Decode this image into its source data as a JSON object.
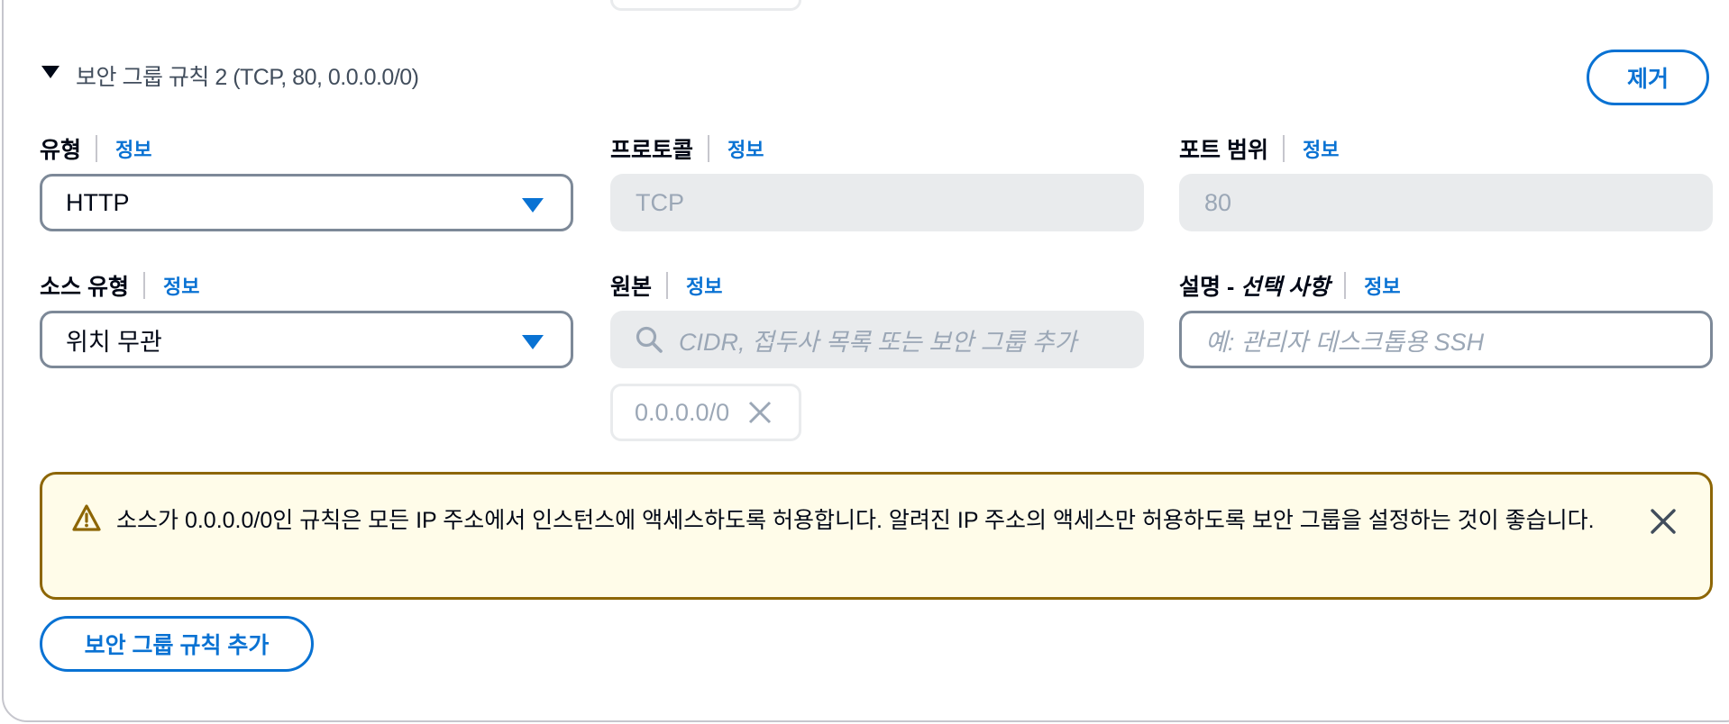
{
  "rule": {
    "title": "보안 그룹 규칙 2 (TCP, 80, 0.0.0.0/0)",
    "remove_label": "제거"
  },
  "fields": {
    "type": {
      "label": "유형",
      "info": "정보",
      "value": "HTTP"
    },
    "protocol": {
      "label": "프로토콜",
      "info": "정보",
      "value": "TCP"
    },
    "port_range": {
      "label": "포트 범위",
      "info": "정보",
      "value": "80"
    },
    "source_type": {
      "label": "소스 유형",
      "info": "정보",
      "value": "위치 무관"
    },
    "source": {
      "label": "원본",
      "info": "정보",
      "placeholder": "CIDR, 접두사 목록 또는 보안 그룹 추가",
      "token": "0.0.0.0/0"
    },
    "description": {
      "label_main": "설명 - ",
      "label_optional": "선택 사항",
      "info": "정보",
      "placeholder": "예: 관리자 데스크톱용 SSH"
    }
  },
  "alert": {
    "text": "소스가 0.0.0.0/0인 규칙은 모든 IP 주소에서 인스턴스에 액세스하도록 허용합니다. 알려진 IP 주소의 액세스만 허용하도록 보안 그룹을 설정하는 것이 좋습니다."
  },
  "add_rule_label": "보안 그룹 규칙 추가",
  "colors": {
    "accent": "#0972d3",
    "warning_border": "#8d6605",
    "warning_bg": "#fffce9",
    "input_border": "#7d8998",
    "disabled_bg": "#e9ebed"
  }
}
